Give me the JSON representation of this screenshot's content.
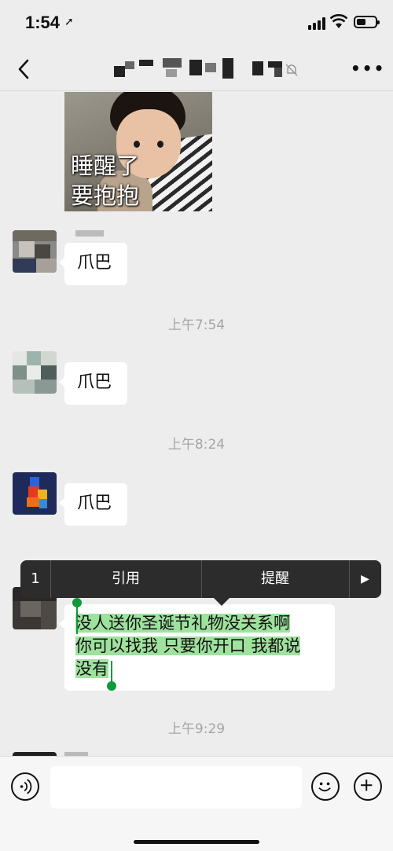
{
  "status_bar": {
    "time": "1:54"
  },
  "chat": {
    "sticker_caption_line1": "睡醒了",
    "sticker_caption_line2": "要抱抱",
    "messages": [
      {
        "text": "爪巴"
      },
      {
        "text": "爪巴"
      },
      {
        "text": "爪巴"
      }
    ],
    "timestamps": [
      "上午7:54",
      "上午8:24",
      "上午9:29"
    ],
    "selected_message": {
      "lines": [
        "没人送你圣诞节礼物没关系啊",
        "你可以找我 只要你开口 我都说",
        "没有"
      ]
    }
  },
  "context_menu": {
    "quote_label": "引用",
    "remind_label": "提醒",
    "left_partial": "1"
  },
  "icons": {
    "back": "chevron-left-icon",
    "mute": "bell-muted-icon",
    "more": "more-dots-icon",
    "voice": "voice-icon",
    "emoji": "emoji-icon",
    "plus": "plus-icon"
  },
  "colors": {
    "background": "#ededed",
    "selection": "#9ee29e",
    "handle": "#0e9a3a",
    "menu_bg": "#2c2c2c"
  }
}
